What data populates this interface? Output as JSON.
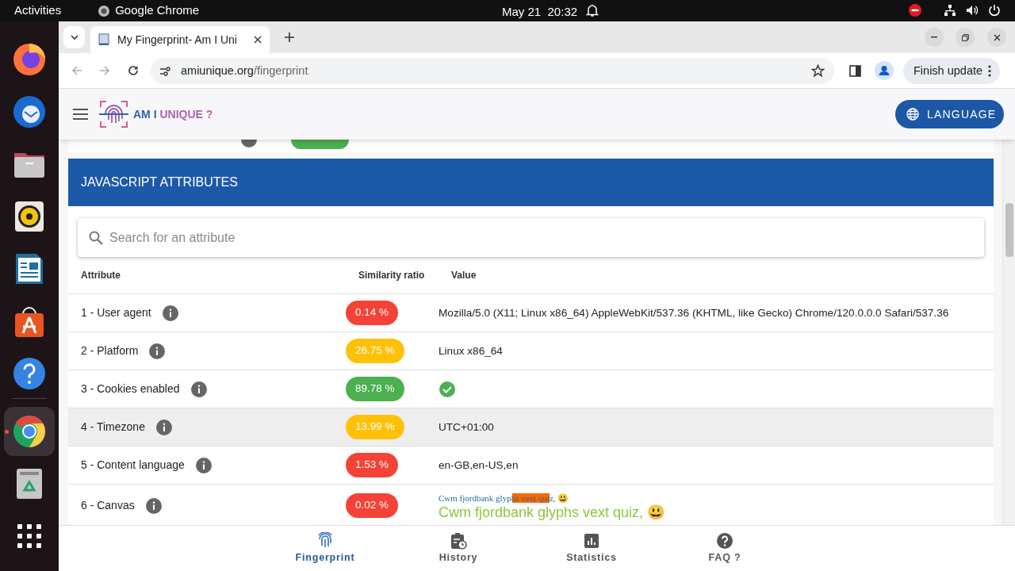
{
  "top_bar": {
    "activities": "Activities",
    "app": "Google Chrome",
    "clock": "May 21  20:32"
  },
  "dock": {
    "items": [
      {
        "kind": "firefox",
        "running": false
      },
      {
        "kind": "thunderbird",
        "running": false
      },
      {
        "kind": "files",
        "running": false
      },
      {
        "kind": "rhythmbox",
        "running": false
      },
      {
        "kind": "writer",
        "running": false
      },
      {
        "kind": "store",
        "running": false
      },
      {
        "kind": "help",
        "running": false
      },
      {
        "kind": "chrome",
        "running": true
      },
      {
        "kind": "trash",
        "running": false
      },
      {
        "kind": "apps",
        "running": false
      }
    ]
  },
  "browser": {
    "tab_title": "My Fingerprint- Am I Uni",
    "url_host": "amiunique.org",
    "url_path": "/fingerprint",
    "update_button": "Finish update"
  },
  "site_header": {
    "logo_text": "AM I ",
    "logo_text_2": "UNIQUE ?",
    "language_button": "LANGUAGE"
  },
  "section": {
    "title": "JAVASCRIPT ATTRIBUTES",
    "search": {
      "placeholder": "Search for an attribute"
    },
    "columns": [
      "Attribute",
      "Similarity ratio",
      "Value"
    ],
    "rows": [
      {
        "attribute": "1 - User agent",
        "ratio": "0.14 %",
        "color": "#f44336",
        "selected": false,
        "kind": "text",
        "value": "Mozilla/5.0 (X11; Linux x86_64) AppleWebKit/537.36 (KHTML, like Gecko) Chrome/120.0.0.0 Safari/537.36"
      },
      {
        "attribute": "2 - Platform",
        "ratio": "26.75 %",
        "color": "#ffc107",
        "selected": false,
        "kind": "text",
        "value": "Linux x86_64"
      },
      {
        "attribute": "3 - Cookies enabled",
        "ratio": "89.78 %",
        "color": "#4caf50",
        "selected": false,
        "kind": "check"
      },
      {
        "attribute": "4 - Timezone",
        "ratio": "13.99 %",
        "color": "#ffc107",
        "selected": true,
        "kind": "text",
        "value": "UTC+01:00"
      },
      {
        "attribute": "5 - Content language",
        "ratio": "1.53 %",
        "color": "#f44336",
        "selected": false,
        "kind": "text",
        "value": "en-GB,en-US,en"
      },
      {
        "attribute": "6 - Canvas",
        "ratio": "0.02 %",
        "color": "#f44336",
        "selected": false,
        "kind": "canvas",
        "canvas_small": "Cwm fjordbank glyphs vext quiz, 😃",
        "canvas_large": "Cwm fjordbank glyphs vext quiz, 😃"
      }
    ]
  },
  "bottom_nav": [
    {
      "label": "Fingerprint",
      "kind": "fingerprint",
      "selected": true
    },
    {
      "label": "History",
      "kind": "history",
      "selected": false
    },
    {
      "label": "Statistics",
      "kind": "stats",
      "selected": false
    },
    {
      "label": "FAQ ?",
      "kind": "faq",
      "selected": false
    }
  ]
}
